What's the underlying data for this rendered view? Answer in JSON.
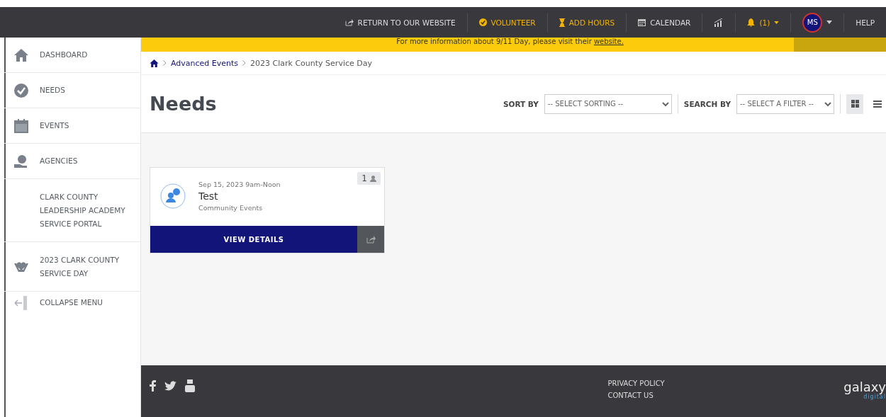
{
  "top_nav": [
    {
      "kind": "link",
      "label": "RETURN TO OUR WEBSITE",
      "accent": false
    },
    {
      "kind": "link",
      "label": "VOLUNTEER",
      "accent": true
    },
    {
      "kind": "link",
      "label": "ADD HOURS",
      "accent": true
    },
    {
      "kind": "link",
      "label": "CALENDAR",
      "accent": false
    },
    {
      "kind": "chart"
    },
    {
      "kind": "bell",
      "label": "(1)"
    },
    {
      "kind": "avatar",
      "label": "MS"
    },
    {
      "kind": "link",
      "label": "HELP",
      "accent": false
    }
  ],
  "banner": {
    "text": "For more information about 9/11 Day, please visit their ",
    "link": "website."
  },
  "sidebar": {
    "items": [
      {
        "label": "DASHBOARD"
      },
      {
        "label": "NEEDS"
      },
      {
        "label": "EVENTS"
      },
      {
        "label": "AGENCIES"
      },
      {
        "label": "CLARK COUNTY LEADERSHIP ACADEMY SERVICE PORTAL"
      },
      {
        "label": "2023 CLARK COUNTY SERVICE DAY"
      },
      {
        "label": "COLLAPSE MENU"
      }
    ]
  },
  "breadcrumb": [
    "Advanced Events",
    "2023 Clark County Service Day"
  ],
  "page_title": "Needs",
  "sort": {
    "label": "SORT BY",
    "placeholder": "-- SELECT SORTING --"
  },
  "search": {
    "label": "SEARCH BY",
    "placeholder": "-- SELECT A FILTER --"
  },
  "view_toggle": [
    {
      "kind": "grid",
      "selected": true
    },
    {
      "kind": "list",
      "selected": false
    }
  ],
  "cards": [
    {
      "date": "Sep 15, 2023  9am-Noon",
      "title": "Test",
      "category": "Community Events",
      "count": "1",
      "button": "VIEW DETAILS"
    }
  ],
  "footer": {
    "links": [
      "PRIVACY POLICY",
      "CONTACT US"
    ],
    "logo": "galaxy",
    "logo_sub": "digital"
  }
}
